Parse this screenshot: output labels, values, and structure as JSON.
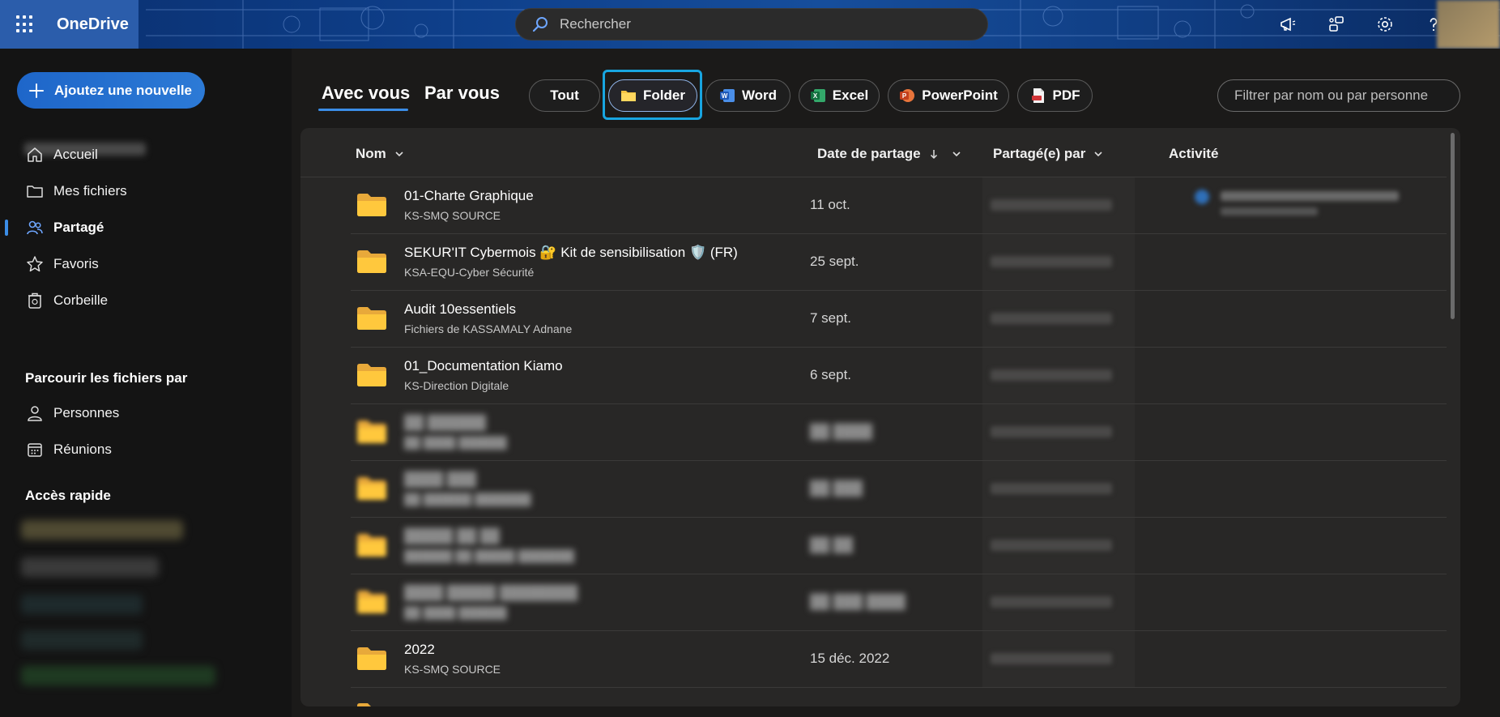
{
  "topbar": {
    "app_name": "OneDrive",
    "search_placeholder": "Rechercher"
  },
  "sidebar": {
    "new_button": "Ajoutez une nouvelle",
    "nav": [
      {
        "label": "Accueil",
        "icon": "home-icon"
      },
      {
        "label": "Mes fichiers",
        "icon": "folder-icon"
      },
      {
        "label": "Partagé",
        "icon": "people-icon",
        "active": true
      },
      {
        "label": "Favoris",
        "icon": "star-icon"
      },
      {
        "label": "Corbeille",
        "icon": "recycle-bin-icon"
      }
    ],
    "browse_title": "Parcourir les fichiers par",
    "browse": [
      {
        "label": "Personnes",
        "icon": "person-icon"
      },
      {
        "label": "Réunions",
        "icon": "calendar-icon"
      }
    ],
    "quick_access_title": "Accès rapide"
  },
  "tabs": {
    "with_you": "Avec vous",
    "by_you": "Par vous"
  },
  "filters": {
    "all": "Tout",
    "folder": "Folder",
    "word": "Word",
    "excel": "Excel",
    "powerpoint": "PowerPoint",
    "pdf": "PDF",
    "search_placeholder": "Filtrer par nom ou par personne"
  },
  "columns": {
    "name": "Nom",
    "date": "Date de partage",
    "shared_by": "Partagé(e) par",
    "activity": "Activité"
  },
  "rows": [
    {
      "name": "01-Charte Graphique",
      "location": "KS-SMQ SOURCE",
      "date": "11 oct."
    },
    {
      "name": "SEKUR'IT Cybermois 🔐 Kit de sensibilisation 🛡️ (FR)",
      "location": "KSA-EQU-Cyber Sécurité",
      "date": "25 sept."
    },
    {
      "name": "Audit 10essentiels",
      "location": "Fichiers de KASSAMALY Adnane",
      "date": "7 sept."
    },
    {
      "name": "01_Documentation Kiamo",
      "location": "KS-Direction Digitale",
      "date": "6 sept."
    },
    {
      "name": "██ ██████",
      "location": "██ ████ ██████",
      "date": "██ ████",
      "blurred": true
    },
    {
      "name": "████ ███",
      "location": "██ ██████ ███████",
      "date": "██ ███",
      "blurred": true
    },
    {
      "name": "█████ ██ ██",
      "location": "██████ ██ █████ ███████",
      "date": "██ ██",
      "blurred": true
    },
    {
      "name": "████ █████ ████████",
      "location": "██ ████ ██████",
      "date": "██ ███ ████",
      "blurred": true
    },
    {
      "name": "2022",
      "location": "KS-SMQ SOURCE",
      "date": "15 déc. 2022"
    }
  ]
}
